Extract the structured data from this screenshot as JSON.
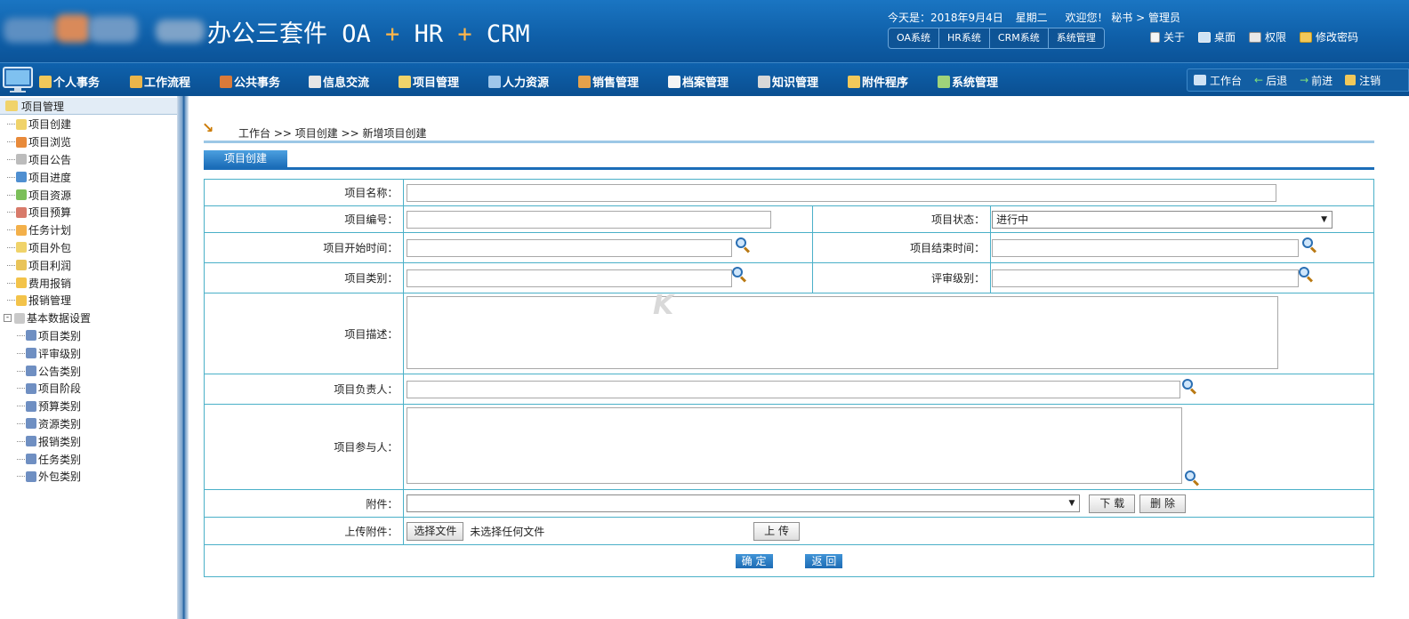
{
  "header": {
    "title_main": "办公三套件",
    "title_parts": [
      "OA",
      "+",
      "HR",
      "+",
      "CRM"
    ],
    "date_text": "今天是：2018年9月4日",
    "weekday": "星期二",
    "welcome": "欢迎您！ 秘书 > 管理员",
    "sys_tabs": [
      "OA系统",
      "HR系统",
      "CRM系统",
      "系统管理"
    ],
    "tools": [
      {
        "label": "关于",
        "icon": "document-icon"
      },
      {
        "label": "桌面",
        "icon": "monitor-icon"
      },
      {
        "label": "权限",
        "icon": "lock-icon"
      },
      {
        "label": "修改密码",
        "icon": "edit-icon"
      }
    ]
  },
  "nav": {
    "items": [
      "个人事务",
      "工作流程",
      "公共事务",
      "信息交流",
      "项目管理",
      "人力资源",
      "销售管理",
      "档案管理",
      "知识管理",
      "附件程序",
      "系统管理"
    ],
    "right": [
      {
        "label": "工作台",
        "icon": "grid-icon"
      },
      {
        "label": "后退",
        "icon": "arrow-left-icon"
      },
      {
        "label": "前进",
        "icon": "arrow-right-icon"
      },
      {
        "label": "注销",
        "icon": "logout-icon"
      }
    ]
  },
  "sidebar": {
    "root": "项目管理",
    "items": [
      "项目创建",
      "项目浏览",
      "项目公告",
      "项目进度",
      "项目资源",
      "项目预算",
      "任务计划",
      "项目外包",
      "项目利润",
      "费用报销",
      "报销管理"
    ],
    "group": "基本数据设置",
    "sub_items": [
      "项目类别",
      "评审级别",
      "公告类别",
      "项目阶段",
      "预算类别",
      "资源类别",
      "报销类别",
      "任务类别",
      "外包类别"
    ]
  },
  "content": {
    "breadcrumb": "工作台 >> 项目创建 >> 新增项目创建",
    "tab": "项目创建",
    "form": {
      "name_label": "项目名称：",
      "code_label": "项目编号：",
      "status_label": "项目状态：",
      "status_value": "进行中",
      "start_label": "项目开始时间：",
      "end_label": "项目结束时间：",
      "category_label": "项目类别：",
      "review_label": "评审级别：",
      "desc_label": "项目描述：",
      "owner_label": "项目负责人：",
      "members_label": "项目参与人：",
      "attach_label": "附件：",
      "upload_label": "上传附件：",
      "choose_file": "选择文件",
      "no_file": "未选择任何文件",
      "download": "下 载",
      "delete": "删 除",
      "upload": "上 传",
      "confirm": "确 定",
      "back": "返 回"
    }
  }
}
